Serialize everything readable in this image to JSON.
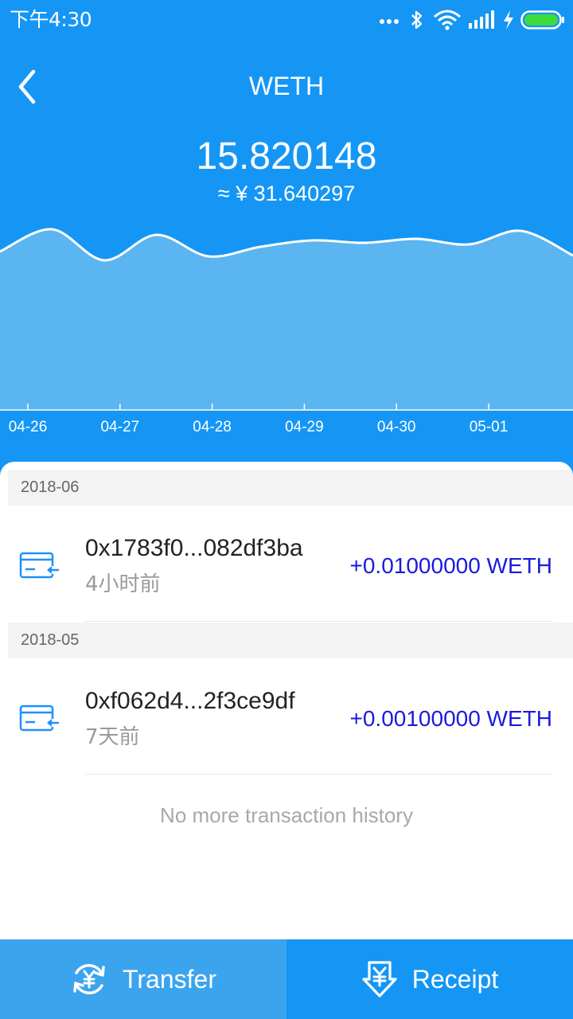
{
  "status_bar": {
    "time": "下午4:30",
    "icons": [
      "more-dots-icon",
      "bluetooth-icon",
      "wifi-icon",
      "signal-icon",
      "charging-bolt-icon",
      "battery-icon"
    ]
  },
  "header": {
    "title": "WETH",
    "back_icon": "back-chevron-icon"
  },
  "balance": {
    "amount": "15.820148",
    "fiat": "≈ ¥ 31.640297"
  },
  "chart_data": {
    "type": "area",
    "x_tick_labels": [
      "04-26",
      "04-27",
      "04-28",
      "04-29",
      "04-30",
      "05-01"
    ],
    "y_axis": "not shown",
    "note_values": "relative trend only, no printed y values",
    "series": [
      {
        "values": [
          0.64,
          0.92,
          0.53,
          0.85,
          0.58,
          0.7,
          0.78,
          0.75,
          0.8,
          0.73,
          0.9,
          0.59
        ]
      }
    ],
    "grid": false,
    "fill_color": "#5bb5f1",
    "line_color": "#ffffff"
  },
  "transactions": {
    "groups": [
      {
        "month": "2018-06",
        "items": [
          {
            "hash": "0x1783f0...082df3ba",
            "time": "4小时前",
            "amount": "+0.01000000 WETH",
            "icon": "receive-card-icon"
          }
        ]
      },
      {
        "month": "2018-05",
        "items": [
          {
            "hash": "0xf062d4...2f3ce9df",
            "time": "7天前",
            "amount": "+0.00100000 WETH",
            "icon": "receive-card-icon"
          }
        ]
      }
    ],
    "end_text": "No more transaction history"
  },
  "actions": {
    "transfer_label": "Transfer",
    "transfer_icon": "yuan-exchange-icon",
    "receipt_label": "Receipt",
    "receipt_icon": "yuan-receive-icon"
  },
  "colors": {
    "primary": "#1596f5",
    "transfer_button": "#3ba4ee",
    "amount_text": "#1a1adc"
  }
}
